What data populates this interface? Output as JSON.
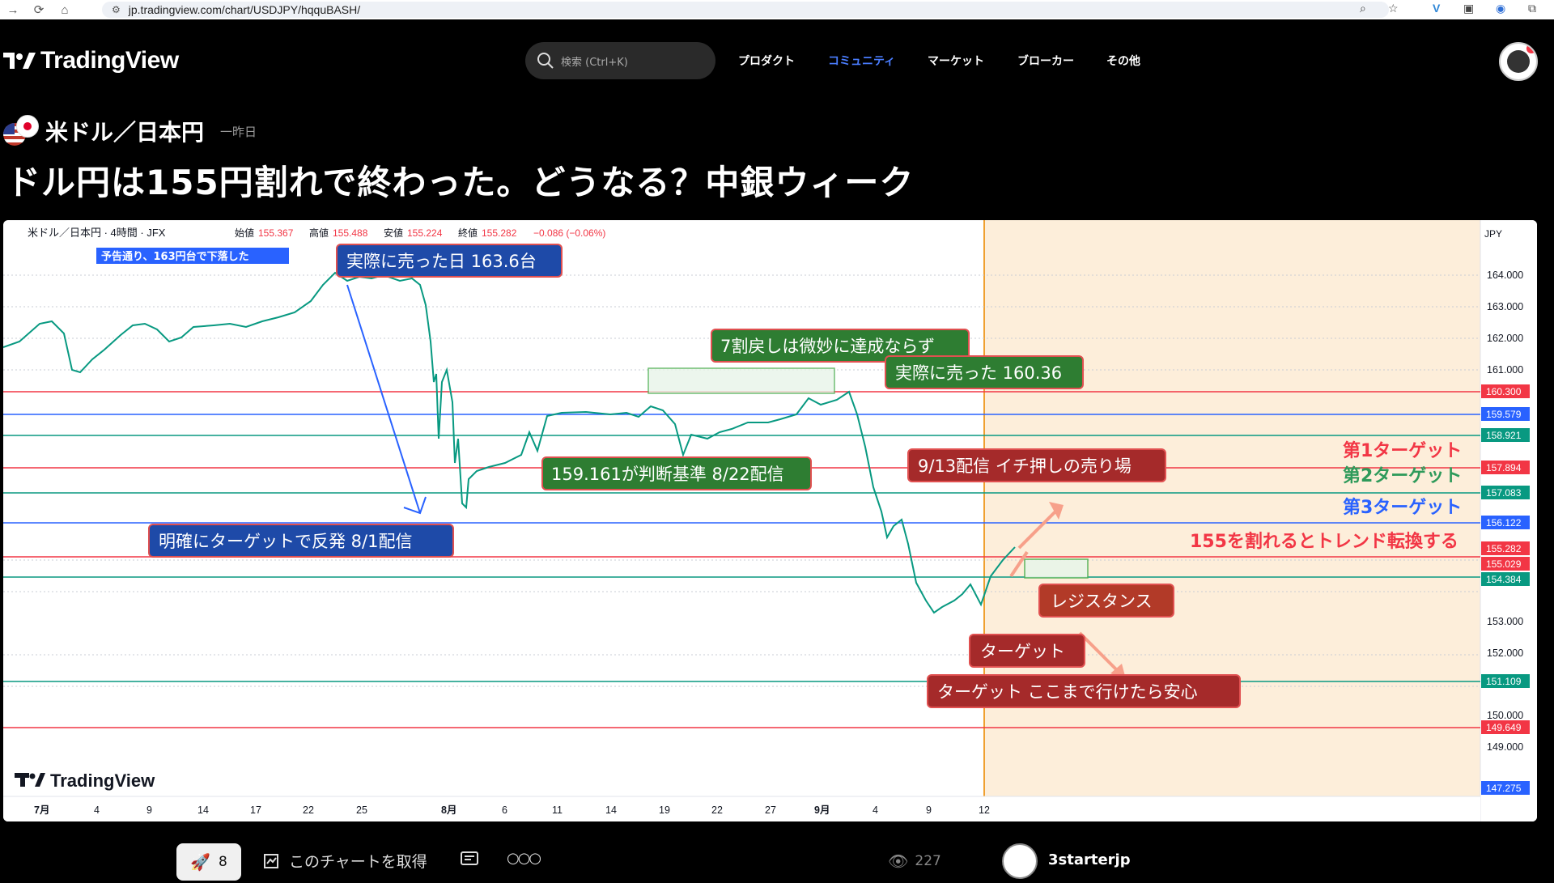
{
  "browser": {
    "url": "jp.tradingview.com/chart/USDJPY/hqquBASH/"
  },
  "header": {
    "logo": "TradingView",
    "search_placeholder": "検索 (Ctrl+K)",
    "nav": [
      "プロダクト",
      "コミュニティ",
      "マーケット",
      "ブローカー",
      "その他"
    ],
    "active_nav_color": "#2962ff"
  },
  "idea": {
    "pair": "米ドル／日本円",
    "posted": "一昨日",
    "title": "ドル円は155円割れで終わった。どうなる？中銀ウィーク"
  },
  "chart": {
    "legend": {
      "symbol": "米ドル／日本円 · 4時間 · JFX",
      "open_label": "始値",
      "open": "155.367",
      "high_label": "高値",
      "high": "155.488",
      "low_label": "安値",
      "low": "155.224",
      "close_label": "終値",
      "close": "155.282",
      "change": "−0.086 (−0.06%)"
    },
    "currency": "JPY",
    "watermark": "TradingView",
    "y_ticks": [
      "164.000",
      "163.000",
      "162.000",
      "161.000",
      "153.000",
      "152.000",
      "150.000",
      "149.000"
    ],
    "x_ticks": [
      "7月",
      "4",
      "9",
      "14",
      "17",
      "22",
      "25",
      "8月",
      "6",
      "11",
      "14",
      "19",
      "22",
      "27",
      "9月",
      "4",
      "9",
      "12"
    ],
    "levels": [
      {
        "price": "160.300",
        "color": "#f23645"
      },
      {
        "price": "159.579",
        "color": "#2962ff"
      },
      {
        "price": "158.921",
        "color": "#089981"
      },
      {
        "price": "157.894",
        "color": "#f23645"
      },
      {
        "price": "157.083",
        "color": "#089981"
      },
      {
        "price": "156.122",
        "color": "#2962ff"
      },
      {
        "price": "155.282",
        "color": "#f23645"
      },
      {
        "price": "155.029",
        "color": "#f23645"
      },
      {
        "price": "154.384",
        "color": "#089981"
      },
      {
        "price": "151.109",
        "color": "#089981"
      },
      {
        "price": "149.649",
        "color": "#f23645"
      },
      {
        "price": "147.275",
        "color": "#2962ff"
      }
    ],
    "annotations": {
      "small_blue": "予告通り、163円台で下落した",
      "sold_day": "実際に売った日 163.6台",
      "retrace": "7割戻しは微妙に達成ならず",
      "sold_160": "実際に売った 160.36",
      "criteria": "159.161が判断基準 8/22配信",
      "bounce": "明確にターゲットで反発 8/1配信",
      "sell_zone": "9/13配信 イチ押しの売り場",
      "resistance": "レジスタンス",
      "target": "ターゲット",
      "target_safe": "ターゲット ここまで行けたら安心",
      "target1": "第1ターゲット",
      "target2": "第2ターゲット",
      "target3": "第3ターゲット",
      "trend_change": "155を割れるとトレンド転換する"
    }
  },
  "footer": {
    "boosts": "8",
    "get_chart": "このチャートを取得",
    "views": "227",
    "author": "3starterjp"
  }
}
